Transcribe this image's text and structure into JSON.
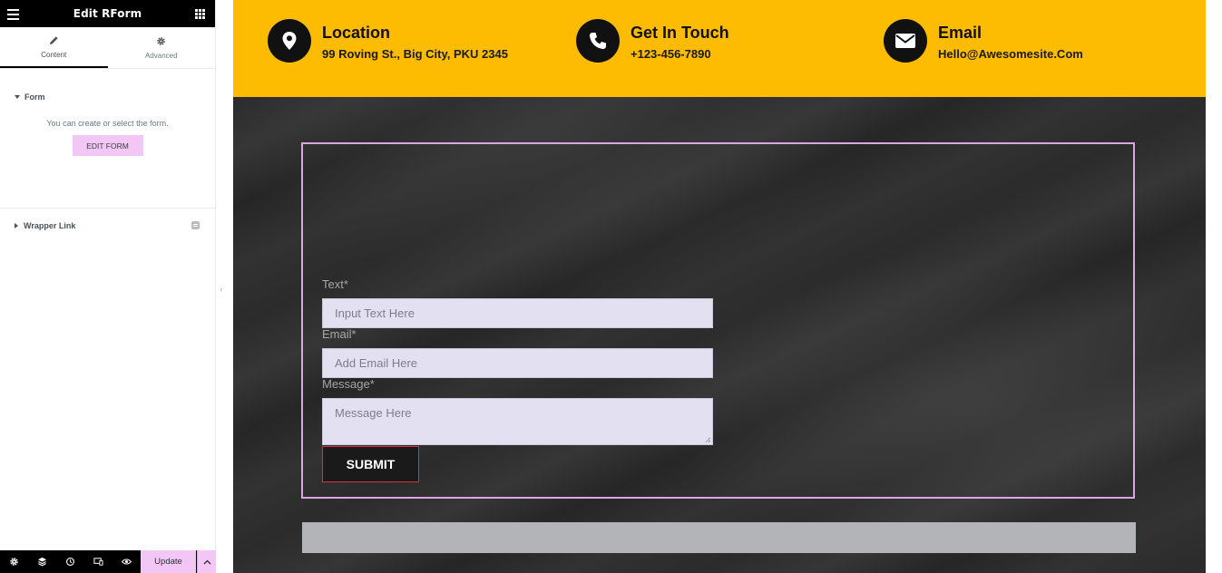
{
  "panel": {
    "title": "Edit RForm",
    "tabs": [
      {
        "label": "Content",
        "icon": "pencil-icon",
        "active": true
      },
      {
        "label": "Advanced",
        "icon": "gear-icon",
        "active": false
      }
    ],
    "form_section": {
      "title": "Form",
      "description": "You can create or select the form.",
      "button_label": "EDIT FORM"
    },
    "wrapper_section": {
      "title": "Wrapper Link"
    },
    "footer": {
      "update_label": "Update"
    }
  },
  "info_bar": {
    "items": [
      {
        "title": "Location",
        "value": "99 Roving St., Big City, PKU 2345",
        "icon": "map-pin-icon"
      },
      {
        "title": "Get In Touch",
        "value": "+123-456-7890",
        "icon": "phone-icon"
      },
      {
        "title": "Email",
        "value": "Hello@Awesomesite.Com",
        "icon": "envelope-icon"
      }
    ]
  },
  "form": {
    "text_label": "Text*",
    "text_placeholder": "Input Text Here",
    "email_label": "Email*",
    "email_placeholder": "Add Email Here",
    "message_label": "Message*",
    "message_placeholder": "Message Here",
    "submit_label": "SUBMIT"
  },
  "colors": {
    "accent_pink": "#f3c7f5",
    "info_bar_yellow": "#fdbc02",
    "form_border": "#dca6e4",
    "submit_border": "#d1334b"
  }
}
